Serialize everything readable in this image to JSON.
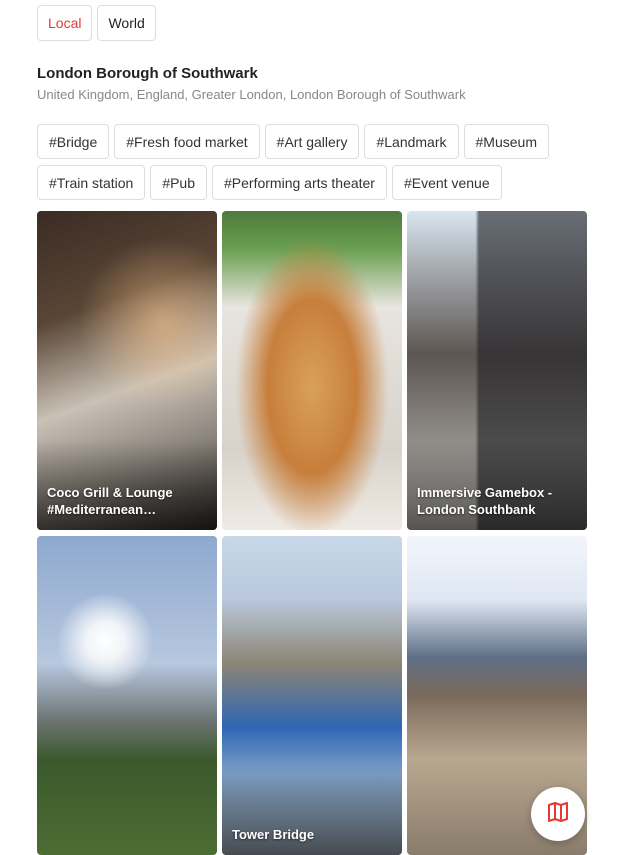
{
  "tabs": [
    {
      "label": "Local",
      "active": true
    },
    {
      "label": "World",
      "active": false
    }
  ],
  "place": {
    "title": "London Borough of Southwark",
    "path": "United Kingdom, England, Greater London, London Borough of Southwark"
  },
  "tags": [
    "#Bridge",
    "#Fresh food market",
    "#Art gallery",
    "#Landmark",
    "#Museum",
    "#Train station",
    "#Pub",
    "#Performing arts theater",
    "#Event venue"
  ],
  "cards": [
    {
      "caption": "Coco Grill & Lounge\n#Mediterranean…"
    },
    {
      "caption": ""
    },
    {
      "caption": "Immersive Gamebox -\nLondon Southbank"
    },
    {
      "caption": ""
    },
    {
      "caption": "Tower Bridge"
    },
    {
      "caption": ""
    }
  ],
  "colors": {
    "accent": "#e53935",
    "border": "#dddddd",
    "muted_text": "#888888"
  },
  "icons": {
    "map_button": "map-icon"
  }
}
